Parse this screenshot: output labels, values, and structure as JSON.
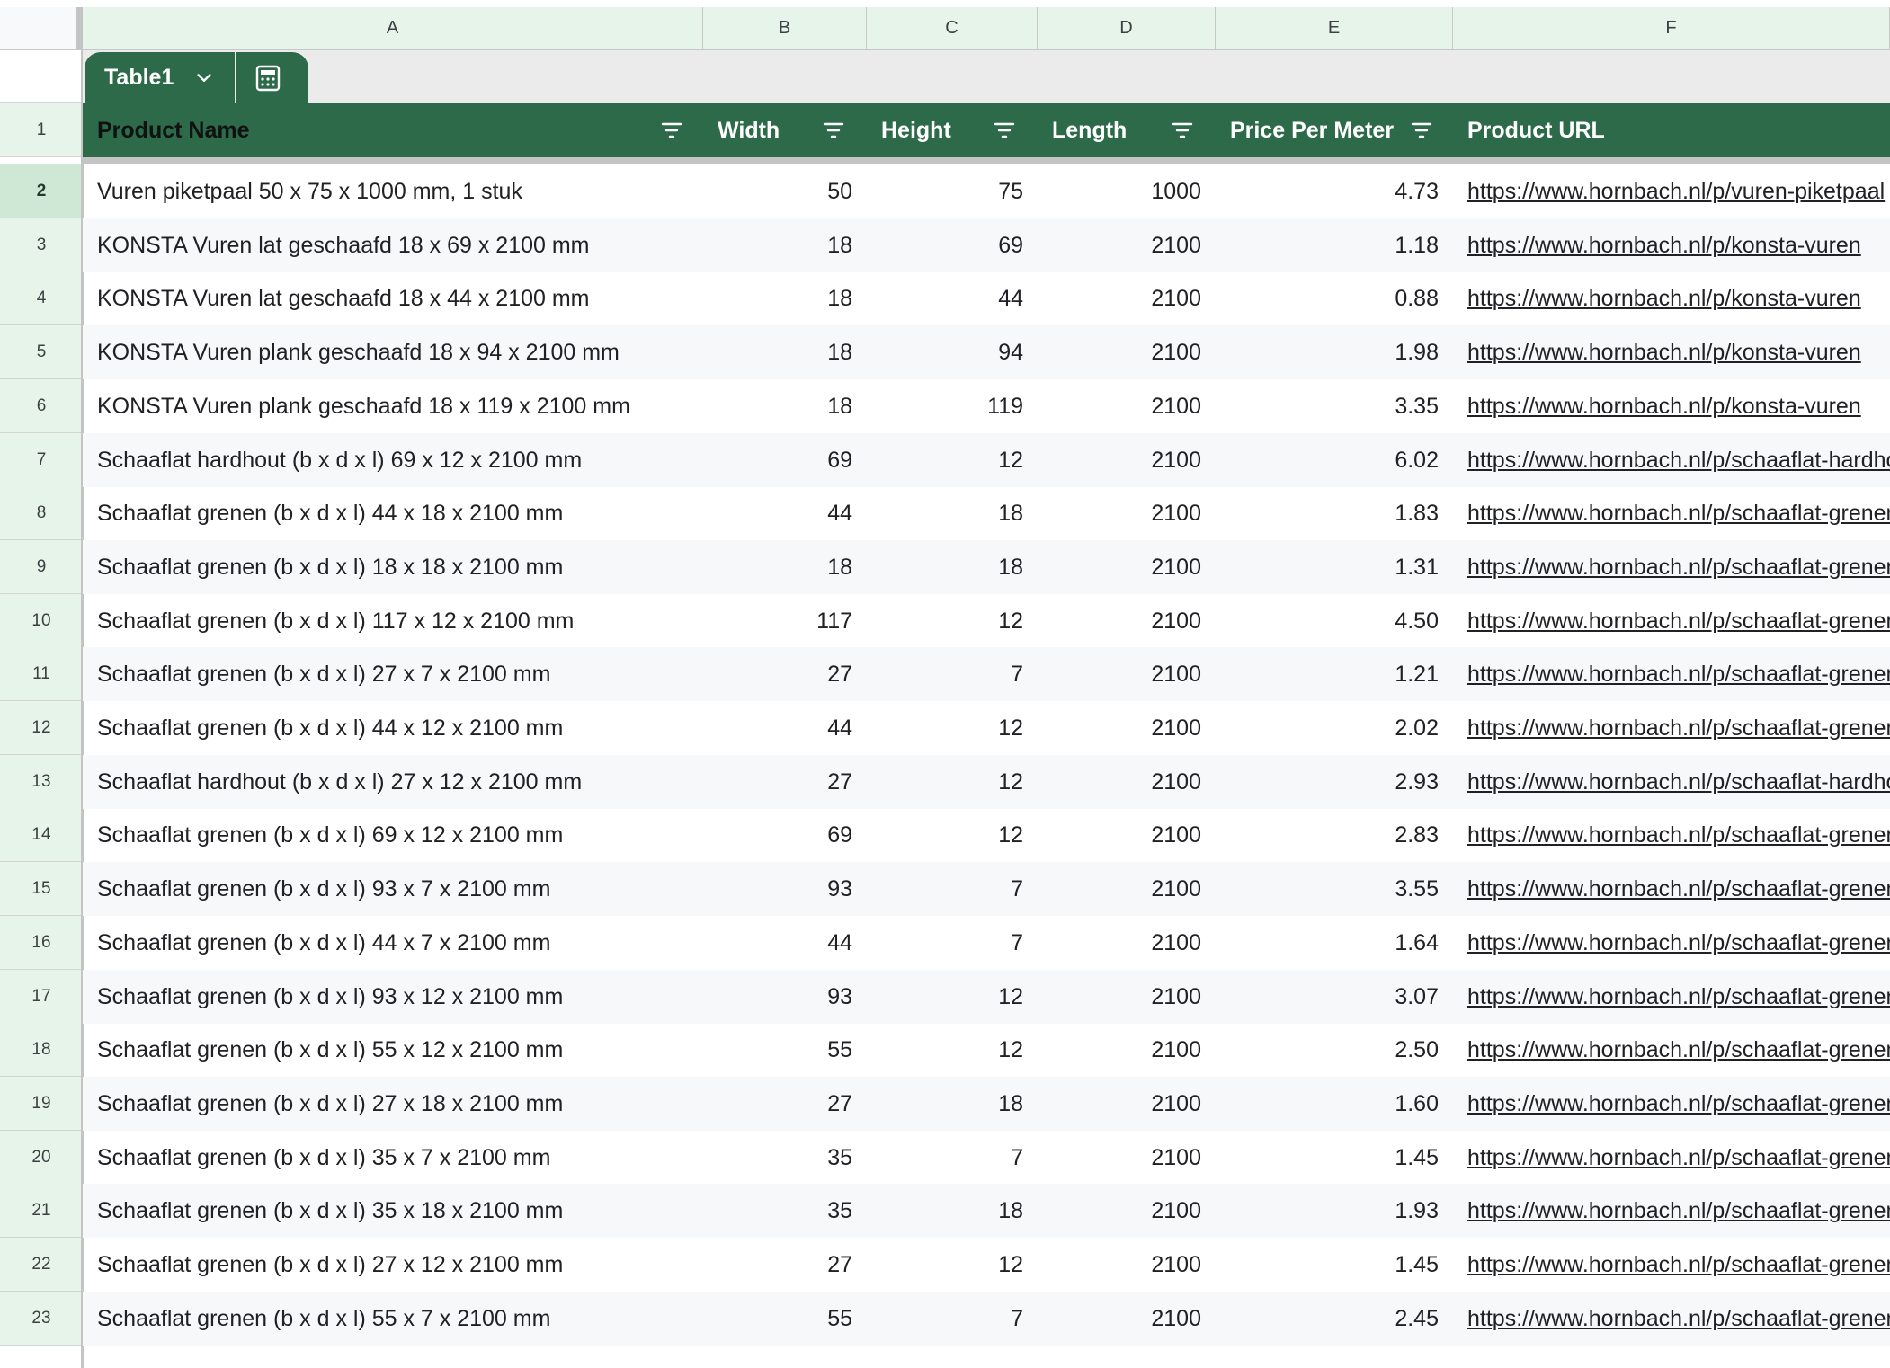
{
  "columns": [
    "A",
    "B",
    "C",
    "D",
    "E",
    "F"
  ],
  "table": {
    "name": "Table1",
    "headers": [
      "Product Name",
      "Width",
      "Height",
      "Length",
      "Price Per Meter",
      "Product URL"
    ]
  },
  "row_numbers": [
    "1",
    "2",
    "3",
    "4",
    "5",
    "6",
    "7",
    "8",
    "9",
    "10",
    "11",
    "12",
    "13",
    "14",
    "15",
    "16",
    "17",
    "18",
    "19",
    "20",
    "21",
    "22",
    "23"
  ],
  "rows": [
    {
      "name": "Vuren piketpaal 50 x 75 x 1000 mm, 1 stuk",
      "width": "50",
      "height": "75",
      "length": "1000",
      "price": "4.73",
      "url": "https://www.hornbach.nl/p/vuren-piketpaal"
    },
    {
      "name": "KONSTA Vuren lat geschaafd 18 x 69 x 2100 mm",
      "width": "18",
      "height": "69",
      "length": "2100",
      "price": "1.18",
      "url": "https://www.hornbach.nl/p/konsta-vuren"
    },
    {
      "name": "KONSTA Vuren lat geschaafd 18 x 44 x 2100 mm",
      "width": "18",
      "height": "44",
      "length": "2100",
      "price": "0.88",
      "url": "https://www.hornbach.nl/p/konsta-vuren"
    },
    {
      "name": "KONSTA Vuren plank geschaafd 18 x 94 x 2100 mm",
      "width": "18",
      "height": "94",
      "length": "2100",
      "price": "1.98",
      "url": "https://www.hornbach.nl/p/konsta-vuren"
    },
    {
      "name": "KONSTA Vuren plank geschaafd 18 x 119 x 2100 mm",
      "width": "18",
      "height": "119",
      "length": "2100",
      "price": "3.35",
      "url": "https://www.hornbach.nl/p/konsta-vuren"
    },
    {
      "name": "Schaaflat hardhout (b x d x l) 69 x 12 x 2100 mm",
      "width": "69",
      "height": "12",
      "length": "2100",
      "price": "6.02",
      "url": "https://www.hornbach.nl/p/schaaflat-hardhout"
    },
    {
      "name": "Schaaflat grenen (b x d x l) 44 x 18 x 2100 mm",
      "width": "44",
      "height": "18",
      "length": "2100",
      "price": "1.83",
      "url": "https://www.hornbach.nl/p/schaaflat-grenen"
    },
    {
      "name": "Schaaflat grenen (b x d x l) 18 x 18 x 2100 mm",
      "width": "18",
      "height": "18",
      "length": "2100",
      "price": "1.31",
      "url": "https://www.hornbach.nl/p/schaaflat-grenen"
    },
    {
      "name": "Schaaflat grenen (b x d x l) 117 x 12 x 2100 mm",
      "width": "117",
      "height": "12",
      "length": "2100",
      "price": "4.50",
      "url": "https://www.hornbach.nl/p/schaaflat-grenen"
    },
    {
      "name": "Schaaflat grenen (b x d x l) 27 x 7 x 2100 mm",
      "width": "27",
      "height": "7",
      "length": "2100",
      "price": "1.21",
      "url": "https://www.hornbach.nl/p/schaaflat-grenen"
    },
    {
      "name": "Schaaflat grenen (b x d x l) 44 x 12 x 2100 mm",
      "width": "44",
      "height": "12",
      "length": "2100",
      "price": "2.02",
      "url": "https://www.hornbach.nl/p/schaaflat-grenen"
    },
    {
      "name": "Schaaflat hardhout (b x d x l) 27 x 12 x 2100 mm",
      "width": "27",
      "height": "12",
      "length": "2100",
      "price": "2.93",
      "url": "https://www.hornbach.nl/p/schaaflat-hardhout"
    },
    {
      "name": "Schaaflat grenen (b x d x l) 69 x 12 x 2100 mm",
      "width": "69",
      "height": "12",
      "length": "2100",
      "price": "2.83",
      "url": "https://www.hornbach.nl/p/schaaflat-grenen"
    },
    {
      "name": "Schaaflat grenen (b x d x l) 93 x 7 x 2100 mm",
      "width": "93",
      "height": "7",
      "length": "2100",
      "price": "3.55",
      "url": "https://www.hornbach.nl/p/schaaflat-grenen"
    },
    {
      "name": "Schaaflat grenen (b x d x l) 44 x 7 x 2100 mm",
      "width": "44",
      "height": "7",
      "length": "2100",
      "price": "1.64",
      "url": "https://www.hornbach.nl/p/schaaflat-grenen"
    },
    {
      "name": "Schaaflat grenen (b x d x l) 93 x 12 x 2100 mm",
      "width": "93",
      "height": "12",
      "length": "2100",
      "price": "3.07",
      "url": "https://www.hornbach.nl/p/schaaflat-grenen"
    },
    {
      "name": "Schaaflat grenen (b x d x l) 55 x 12 x 2100 mm",
      "width": "55",
      "height": "12",
      "length": "2100",
      "price": "2.50",
      "url": "https://www.hornbach.nl/p/schaaflat-grenen"
    },
    {
      "name": "Schaaflat grenen (b x d x l) 27 x 18 x 2100 mm",
      "width": "27",
      "height": "18",
      "length": "2100",
      "price": "1.60",
      "url": "https://www.hornbach.nl/p/schaaflat-grenen"
    },
    {
      "name": "Schaaflat grenen (b x d x l) 35 x 7 x 2100 mm",
      "width": "35",
      "height": "7",
      "length": "2100",
      "price": "1.45",
      "url": "https://www.hornbach.nl/p/schaaflat-grenen"
    },
    {
      "name": "Schaaflat grenen (b x d x l) 35 x 18 x 2100 mm",
      "width": "35",
      "height": "18",
      "length": "2100",
      "price": "1.93",
      "url": "https://www.hornbach.nl/p/schaaflat-grenen"
    },
    {
      "name": "Schaaflat grenen (b x d x l) 27 x 12 x 2100 mm",
      "width": "27",
      "height": "12",
      "length": "2100",
      "price": "1.45",
      "url": "https://www.hornbach.nl/p/schaaflat-grenen"
    },
    {
      "name": "Schaaflat grenen (b x d x l) 55 x 7 x 2100 mm",
      "width": "55",
      "height": "7",
      "length": "2100",
      "price": "2.45",
      "url": "https://www.hornbach.nl/p/schaaflat-grenen"
    }
  ],
  "icons": {
    "tab_dropdown": "chevron-down-icon",
    "tab_calculator": "calculator-icon",
    "column_filter": "filter-icon"
  },
  "colors": {
    "table_header": "#2d6a4a",
    "column_header_bg": "#e6f4ea",
    "selected_row_num": "#cfe8d6"
  }
}
